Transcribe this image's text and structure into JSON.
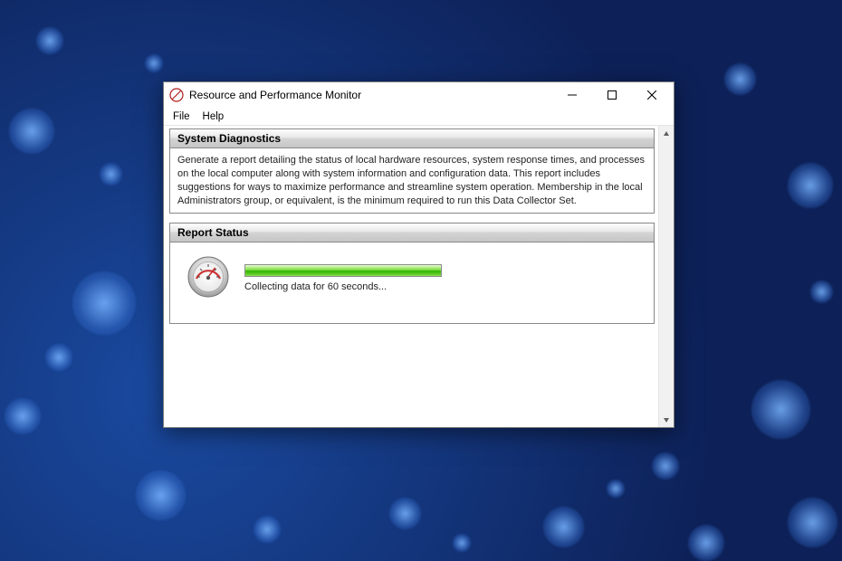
{
  "window": {
    "title": "Resource and Performance Monitor"
  },
  "menu": {
    "file": "File",
    "help": "Help"
  },
  "sections": {
    "diagnostics": {
      "title": "System Diagnostics",
      "body": "Generate a report detailing the status of local hardware resources, system response times, and processes on the local computer along with system information and configuration data. This report includes suggestions for ways to maximize performance and streamline system operation. Membership in the local Administrators group, or equivalent, is the minimum required to run this Data Collector Set."
    },
    "report_status": {
      "title": "Report Status",
      "status_text": "Collecting data for 60 seconds..."
    }
  }
}
